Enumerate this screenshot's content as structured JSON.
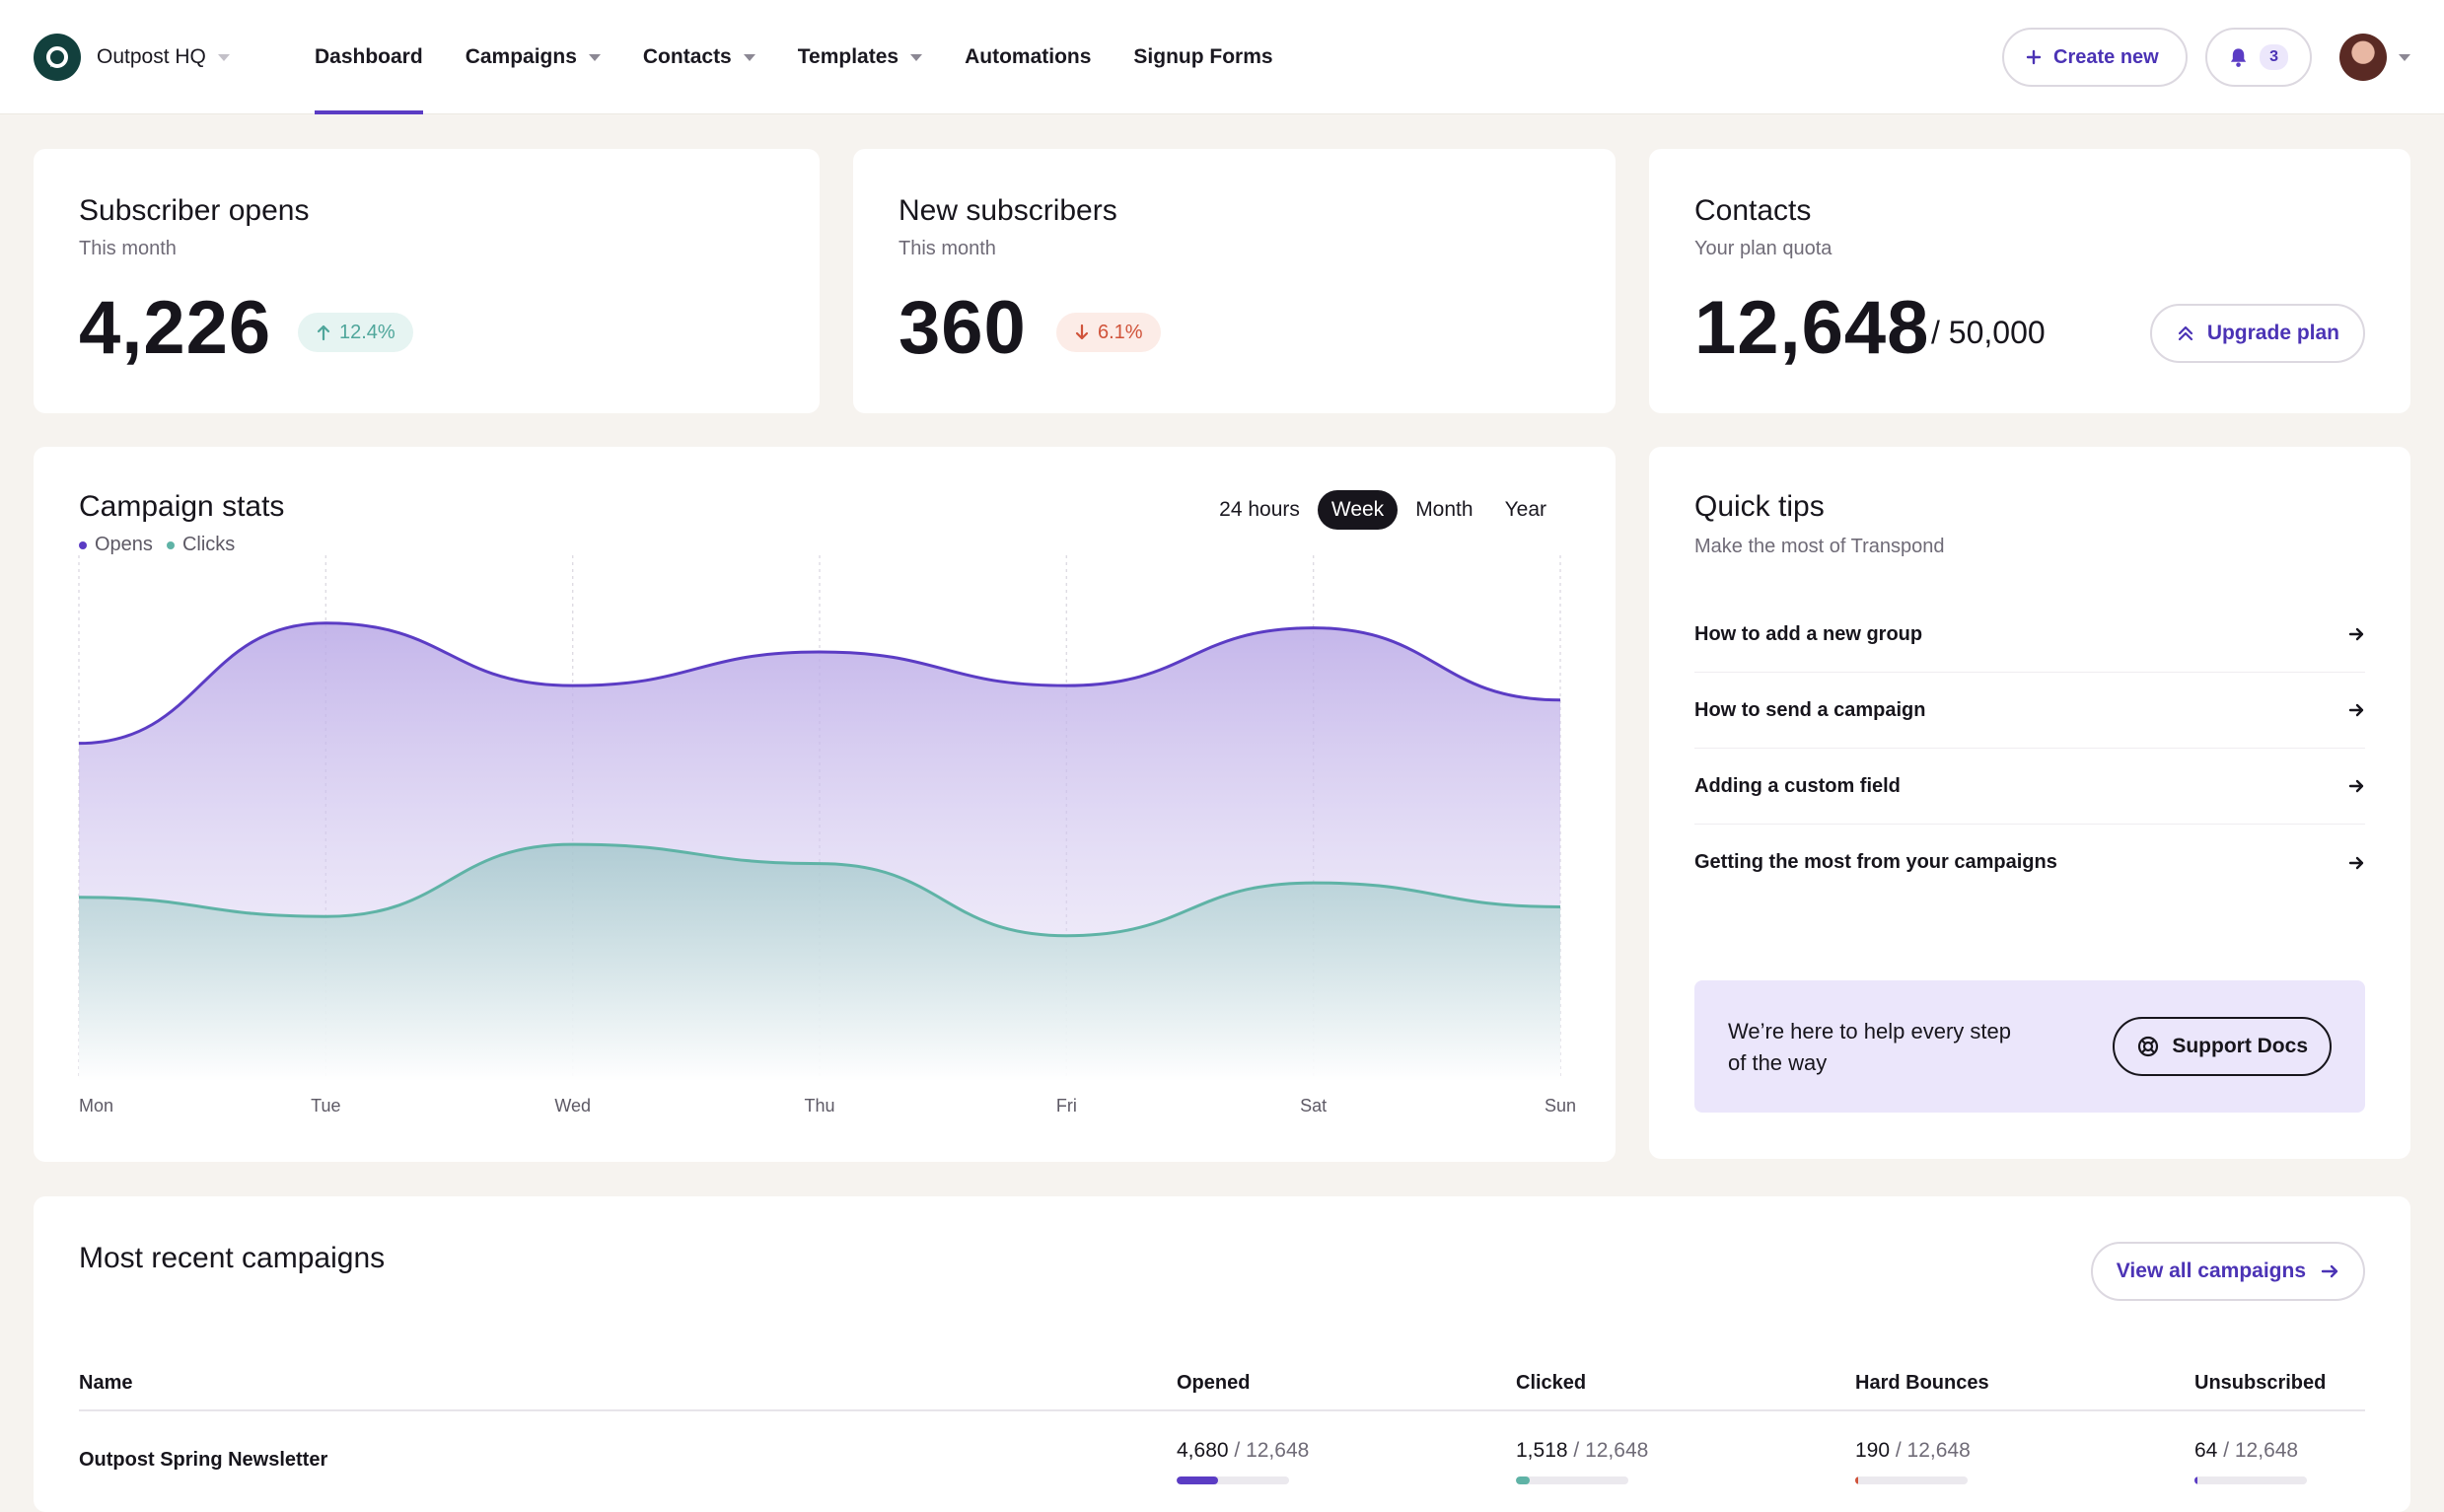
{
  "brand": {
    "name": "Outpost HQ"
  },
  "nav": {
    "items": [
      {
        "label": "Dashboard",
        "active": true,
        "dropdown": false
      },
      {
        "label": "Campaigns",
        "active": false,
        "dropdown": true
      },
      {
        "label": "Contacts",
        "active": false,
        "dropdown": true
      },
      {
        "label": "Templates",
        "active": false,
        "dropdown": true
      },
      {
        "label": "Automations",
        "active": false,
        "dropdown": false
      },
      {
        "label": "Signup Forms",
        "active": false,
        "dropdown": false
      }
    ]
  },
  "header": {
    "create_label": "Create new",
    "notification_count": "3"
  },
  "stats": {
    "opens": {
      "title": "Subscriber opens",
      "subtitle": "This month",
      "value": "4,226",
      "change": "12.4%",
      "direction": "up"
    },
    "subscribers": {
      "title": "New subscribers",
      "subtitle": "This month",
      "value": "360",
      "change": "6.1%",
      "direction": "down"
    },
    "contacts": {
      "title": "Contacts",
      "subtitle": "Your plan quota",
      "value": "12,648",
      "quota": "/ 50,000",
      "upgrade_label": "Upgrade plan"
    }
  },
  "campaign_stats": {
    "title": "Campaign stats",
    "ranges": [
      "24 hours",
      "Week",
      "Month",
      "Year"
    ],
    "active_range": "Week",
    "legend": [
      {
        "label": "Opens",
        "color": "#5b3cc4"
      },
      {
        "label": "Clicks",
        "color": "#5fb3a6"
      }
    ]
  },
  "chart_data": {
    "type": "area",
    "categories": [
      "Mon",
      "Tue",
      "Wed",
      "Thu",
      "Fri",
      "Sat",
      "Sun"
    ],
    "series": [
      {
        "name": "Opens",
        "values": [
          0.7,
          0.95,
          0.82,
          0.89,
          0.82,
          0.94,
          0.79
        ]
      },
      {
        "name": "Clicks",
        "values": [
          0.38,
          0.34,
          0.49,
          0.45,
          0.3,
          0.41,
          0.36
        ]
      }
    ],
    "ylim": [
      0,
      1.05
    ],
    "grid": "vertical-dashed"
  },
  "quick_tips": {
    "title": "Quick tips",
    "subtitle": "Make the most of Transpond",
    "items": [
      "How to add a new group",
      "How to send a campaign",
      "Adding a custom field",
      "Getting the most from your campaigns"
    ],
    "help_text": "We’re here to help every step of the way",
    "support_label": "Support Docs"
  },
  "recent": {
    "title": "Most recent campaigns",
    "view_all_label": "View all campaigns",
    "columns": [
      "Name",
      "Opened",
      "Clicked",
      "Hard Bounces",
      "Unsubscribed"
    ],
    "rows": [
      {
        "name": "Outpost Spring Newsletter",
        "opened": "4,680",
        "clicked": "1,518",
        "bounces": "190",
        "unsubscribed": "64",
        "total": "/ 12,648",
        "opened_ratio": 0.37,
        "clicked_ratio": 0.12,
        "bounces_ratio": 0.015,
        "unsubscribed_ratio": 0.005
      }
    ]
  },
  "colors": {
    "accent": "#5b3cc4",
    "teal": "#5fb3a6",
    "down": "#d0533a",
    "bounce": "#d0533a"
  }
}
